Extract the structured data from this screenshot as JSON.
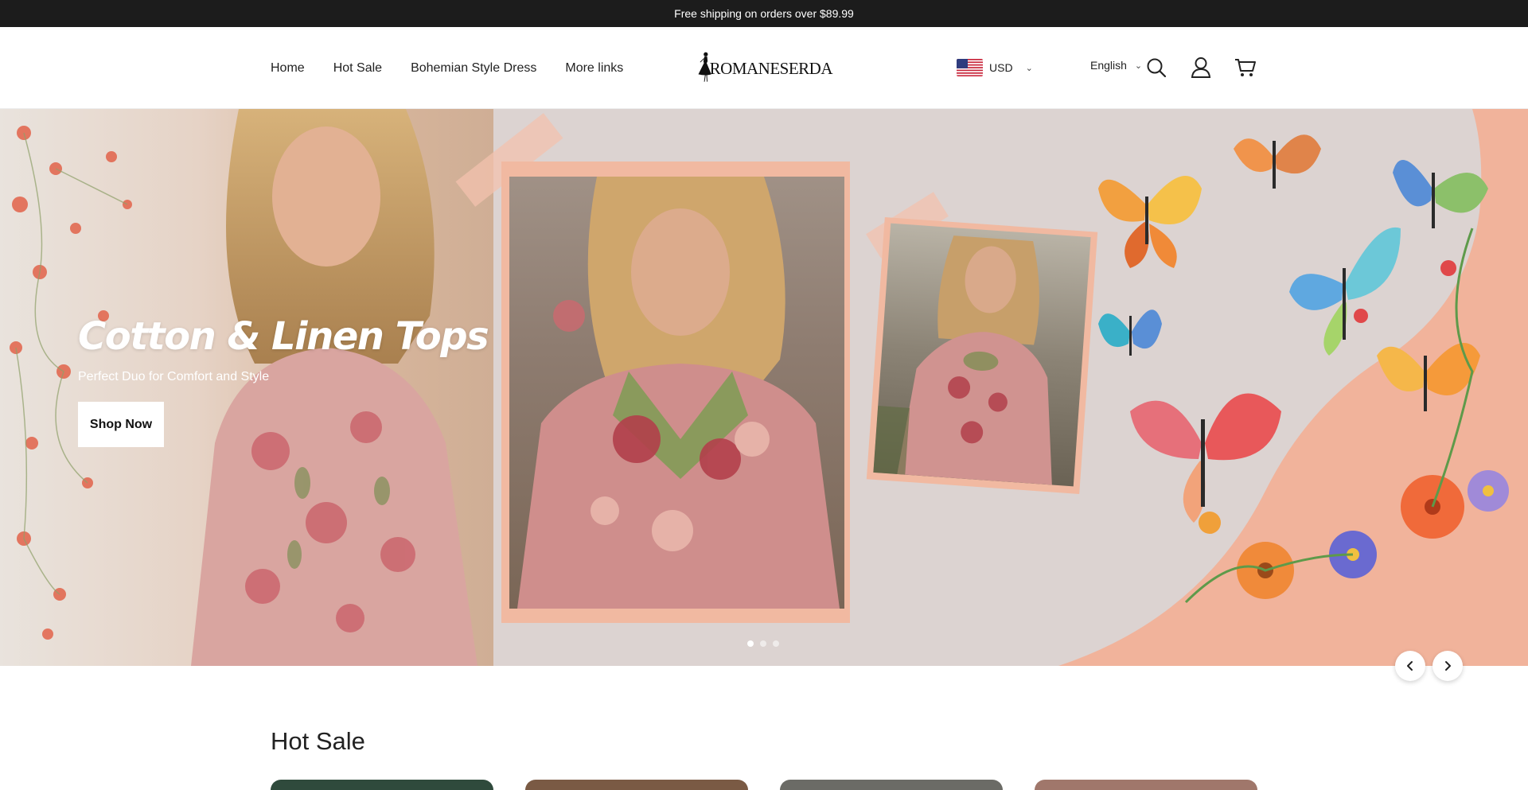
{
  "announcement": {
    "text": "Free shipping on orders over $89.99"
  },
  "nav": {
    "items": [
      {
        "label": "Home"
      },
      {
        "label": "Hot Sale"
      },
      {
        "label": "Bohemian Style Dress"
      },
      {
        "label": "More links"
      }
    ]
  },
  "logo": {
    "text": "ROMANESERDA"
  },
  "header": {
    "currency": "USD",
    "language": "English",
    "icons": [
      "search-icon",
      "account-icon",
      "cart-icon"
    ]
  },
  "hero": {
    "title": "Cotton & Linen Tops",
    "subtitle": "Perfect Duo for Comfort and Style",
    "cta": "Shop Now",
    "slides_total": 3,
    "active_slide": 1
  },
  "hot_sale": {
    "title": "Hot Sale",
    "card_colors": [
      "#2f4a3c",
      "#7a5a44",
      "#6b6b66",
      "#a0776b"
    ]
  },
  "colors": {
    "announcement_bg": "#1c1c1c",
    "frame_peach": "#f1b9a1",
    "hero_bg": "#dcd3d1"
  }
}
